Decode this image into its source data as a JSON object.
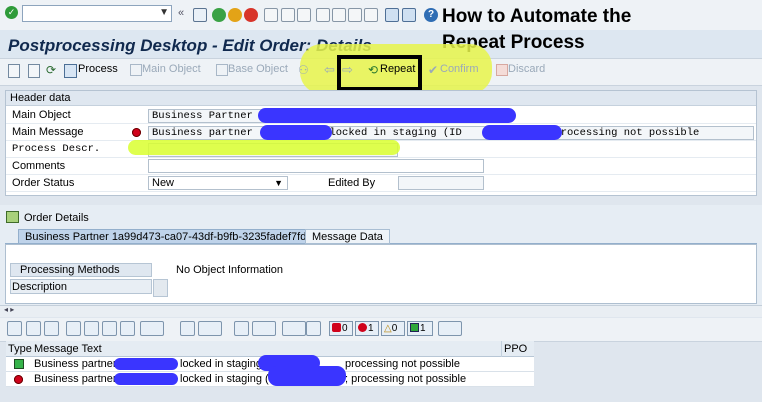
{
  "headline": {
    "line1": "How to Automate the",
    "line2": "Repeat Process"
  },
  "window": {
    "title": "Postprocessing Desktop - Edit Order: Details"
  },
  "app_toolbar": {
    "process": "Process",
    "main_object": "Main Object",
    "base_object": "Base Object",
    "repeat": "Repeat",
    "confirm": "Confirm",
    "discard": "Discard"
  },
  "header_data": {
    "section_title": "Header data",
    "main_object_label": "Main Object",
    "main_object_value": "Business Partner",
    "main_message_label": "Main Message",
    "main_message_value_a": "Business partner",
    "main_message_value_b": "locked in staging (ID",
    "main_message_value_c": "processing not possible",
    "process_descr_label": "Process Descr.",
    "comments_label": "Comments",
    "order_status_label": "Order Status",
    "order_status_value": "New",
    "edited_by_label": "Edited By"
  },
  "order_details": {
    "title": "Order Details",
    "tabs": [
      "Business Partner 1a99d473-ca07-43df-b9fb-3235fadef7fd",
      "Message Data"
    ],
    "processing_methods": "Processing Methods",
    "description_header": "Description",
    "no_object_info": "No Object Information"
  },
  "status_counts": {
    "errors": "0",
    "warnings_red": "1",
    "warnings": "0",
    "info": "1"
  },
  "messages": {
    "columns": [
      "Type",
      "Message Text",
      "PPO"
    ],
    "rows": [
      {
        "type": "green",
        "text_a": "Business partner",
        "text_b": "locked in staging",
        "text_c": "processing not possible"
      },
      {
        "type": "red",
        "text_a": "Business partner",
        "text_b": "locked in staging (ID",
        "text_c": "; processing not possible"
      }
    ]
  },
  "colors": {
    "highlight": "#e8f54a",
    "scribble": "#3a35ff",
    "title": "#10294e"
  }
}
